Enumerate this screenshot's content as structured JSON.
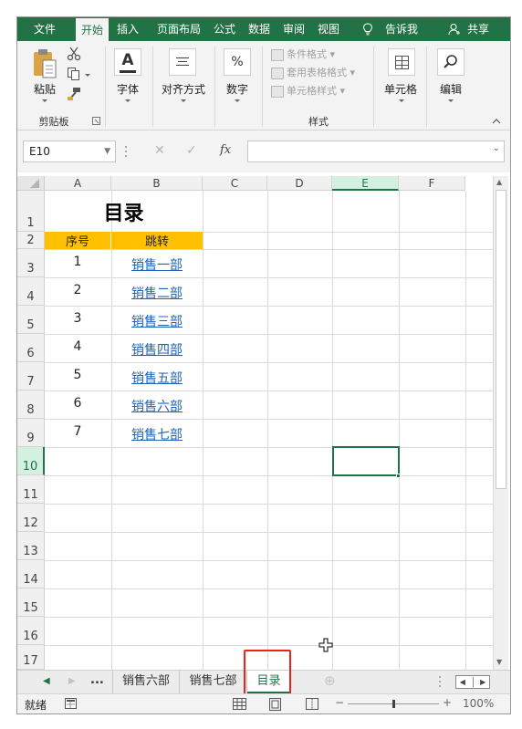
{
  "ribbon_tabs": [
    "文件",
    "开始",
    "插入",
    "页面布局",
    "公式",
    "数据",
    "审阅",
    "视图",
    "告诉我",
    "共享"
  ],
  "active_tab": "开始",
  "ribbon": {
    "paste_label": "粘贴",
    "clipboard_group": "剪贴板",
    "font_label": "字体",
    "font_icon": "A",
    "align_label": "对齐方式",
    "number_label": "数字",
    "number_icon": "%",
    "conditional_format": "条件格式",
    "format_as_table": "套用表格格式",
    "cell_styles": "单元格样式",
    "styles_group": "样式",
    "cells_label": "单元格",
    "editing_label": "编辑"
  },
  "formula_bar": {
    "name_box": "E10",
    "cancel": "✕",
    "enter": "✓",
    "fx": "fx",
    "formula": ""
  },
  "columns": [
    "A",
    "B",
    "C",
    "D",
    "E",
    "F"
  ],
  "rows": [
    "1",
    "2",
    "3",
    "4",
    "5",
    "6",
    "7",
    "8",
    "9",
    "10",
    "11",
    "12",
    "13",
    "14",
    "15",
    "16",
    "17"
  ],
  "selected_cell": "E10",
  "sheet": {
    "title": "目录",
    "header_index": "序号",
    "header_jump": "跳转",
    "header_fill": "#ffc000",
    "entries": [
      {
        "no": "1",
        "link": "销售一部"
      },
      {
        "no": "2",
        "link": "销售二部"
      },
      {
        "no": "3",
        "link": "销售三部"
      },
      {
        "no": "4",
        "link": "销售四部"
      },
      {
        "no": "5",
        "link": "销售五部"
      },
      {
        "no": "6",
        "link": "销售六部"
      },
      {
        "no": "7",
        "link": "销售七部"
      }
    ]
  },
  "sheet_tabs": {
    "ellipsis": "...",
    "tabs": [
      "销售六部",
      "销售七部",
      "目录"
    ],
    "active": "目录",
    "add": "⊕"
  },
  "status_bar": {
    "status": "就绪",
    "zoom_minus": "−",
    "zoom_plus": "+",
    "zoom": "100%",
    "zoom_level": 1.0
  },
  "colors": {
    "brand": "#217346",
    "highlight_box": "#e8231b",
    "link": "#1f63b7"
  }
}
